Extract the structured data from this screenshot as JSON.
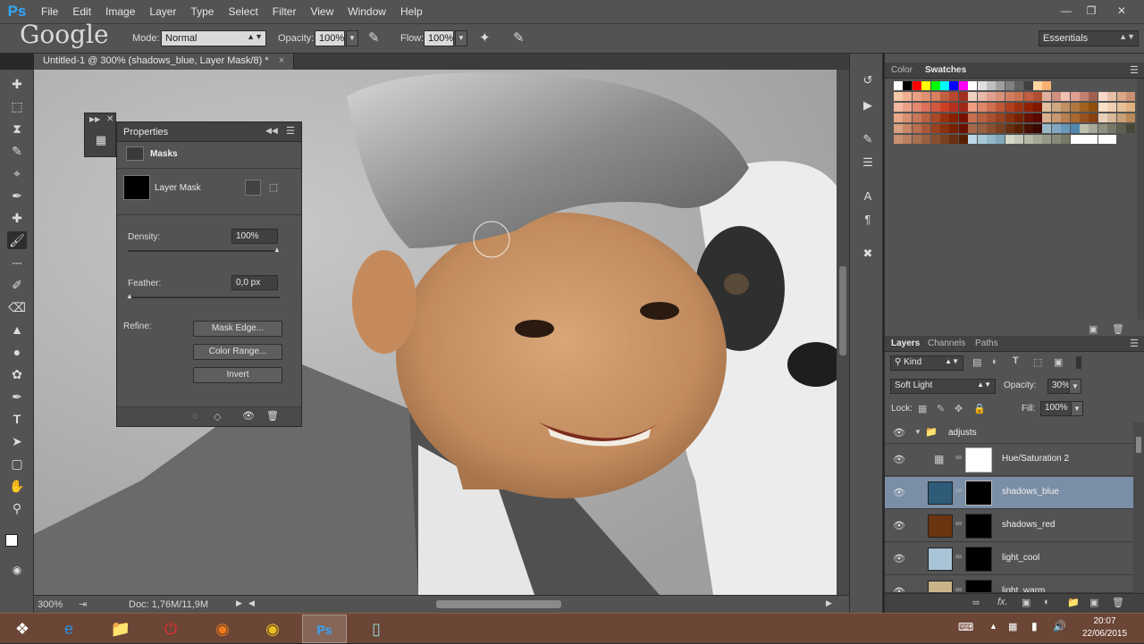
{
  "app": {
    "logo": "Ps",
    "accent": "#31a8ff"
  },
  "menu": [
    "File",
    "Edit",
    "Image",
    "Layer",
    "Type",
    "Select",
    "Filter",
    "View",
    "Window",
    "Help"
  ],
  "watermark": "Google",
  "options": {
    "mode_label": "Mode:",
    "mode_value": "Normal",
    "opacity_label": "Opacity:",
    "opacity_value": "100%",
    "flow_label": "Flow:",
    "flow_value": "100%",
    "workspace": "Essentials"
  },
  "document": {
    "tab_title": "Untitled-1 @ 300% (shadows_blue, Layer Mask/8) *",
    "close": "×"
  },
  "status": {
    "zoom": "300%",
    "doc": "Doc: 1,76M/11,9M"
  },
  "properties": {
    "title": "Properties",
    "section": "Masks",
    "mask_label": "Layer Mask",
    "density_label": "Density:",
    "density_value": "100%",
    "feather_label": "Feather:",
    "feather_value": "0,0 px",
    "refine_label": "Refine:",
    "buttons": [
      "Mask Edge...",
      "Color Range...",
      "Invert"
    ]
  },
  "color_panel": {
    "tabs": [
      "Color",
      "Swatches"
    ]
  },
  "layers_panel": {
    "tabs": [
      "Layers",
      "Channels",
      "Paths"
    ],
    "filter_kind": "Kind",
    "blend_mode": "Soft Light",
    "opacity_label": "Opacity:",
    "opacity_value": "30%",
    "lock_label": "Lock:",
    "fill_label": "Fill:",
    "fill_value": "100%",
    "group": "adjusts",
    "layers": [
      {
        "name": "Hue/Saturation 2",
        "thumb": "#9a9a9a",
        "mask": "#ffffff",
        "selected": false
      },
      {
        "name": "shadows_blue",
        "thumb": "#2d5b78",
        "mask": "#000000",
        "selected": true
      },
      {
        "name": "shadows_red",
        "thumb": "#6b3410",
        "mask": "#000000",
        "selected": false
      },
      {
        "name": "light_cool",
        "thumb": "#a9c4d6",
        "mask": "#000000",
        "selected": false
      },
      {
        "name": "light_warm",
        "thumb": "#c9b48a",
        "mask": "#000000",
        "selected": false
      }
    ]
  },
  "taskbar": {
    "time": "20:07",
    "date": "22/06/2015"
  }
}
